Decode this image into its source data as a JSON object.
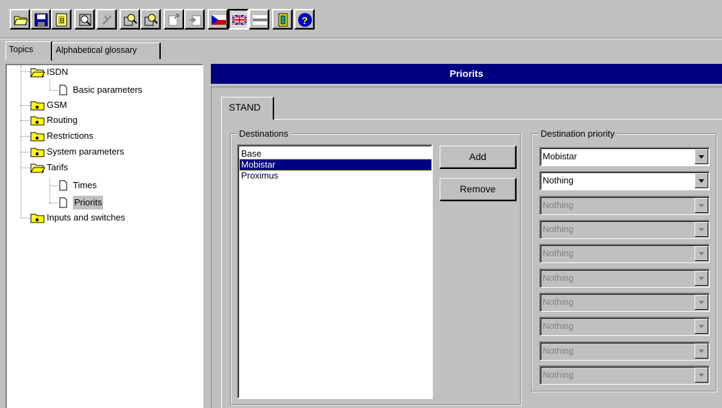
{
  "toolbar": {
    "buttons": [
      "open-folder-icon",
      "save-icon",
      "properties-icon",
      "import-icon",
      "cancel-icon",
      "find-icon",
      "find-next-icon",
      "export-icon",
      "paste-icon",
      "czech-flag-icon",
      "uk-flag-icon",
      "blank-flag-icon",
      "exit-icon",
      "help-icon"
    ]
  },
  "nav_tabs": {
    "topics": "Topics",
    "glossary": "Alphabetical glossary"
  },
  "tree": {
    "items": [
      {
        "label": "ISDN"
      },
      {
        "label": "Basic parameters"
      },
      {
        "label": "GSM"
      },
      {
        "label": "Routing"
      },
      {
        "label": "Restrictions"
      },
      {
        "label": "System parameters"
      },
      {
        "label": "Tarifs"
      },
      {
        "label": "Times"
      },
      {
        "label": "Priorits"
      },
      {
        "label": "Inputs and switches"
      }
    ]
  },
  "main": {
    "title": "Priorits",
    "tab": "STAND",
    "destinations": {
      "label": "Destinations",
      "items": [
        "Base",
        "Mobistar",
        "Proximus"
      ],
      "selected": "Mobistar"
    },
    "buttons": {
      "add": "Add",
      "remove": "Remove"
    },
    "priority": {
      "label": "Destination priority",
      "values": [
        "Mobistar",
        "Nothing",
        "Nothing",
        "Nothing",
        "Nothing",
        "Nothing",
        "Nothing",
        "Nothing",
        "Nothing",
        "Nothing"
      ]
    }
  }
}
